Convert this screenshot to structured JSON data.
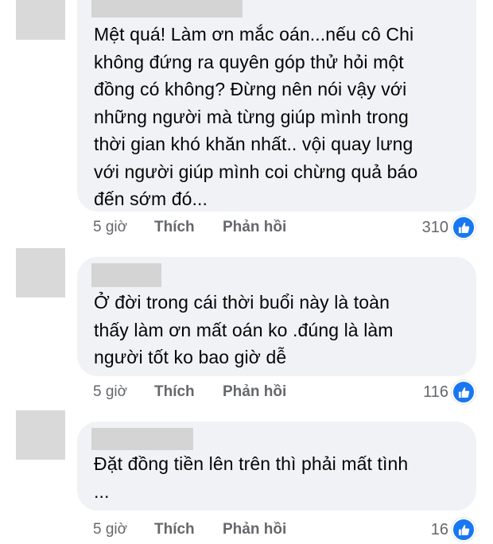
{
  "comments": [
    {
      "text": "Mệt quá! Làm ơn mắc oán...nếu cô Chi\nkhông đứng ra quyên góp thử hỏi một\nđồng có không? Đừng nên nói vậy với\nnhững người mà từng giúp mình trong\nthời gian khó khăn nhất.. vội quay lưng\nvới người giúp mình coi chừng quả báo\nđến sớm đó...",
      "time": "5 giờ",
      "like_label": "Thích",
      "reply_label": "Phản hồi",
      "reaction_count": "310"
    },
    {
      "text": "Ở đời trong cái thời buổi này là toàn\nthấy làm ơn mất oán ko .đúng là làm\nngười tốt ko bao giờ dễ",
      "time": "5 giờ",
      "like_label": "Thích",
      "reply_label": "Phản hồi",
      "reaction_count": "116"
    },
    {
      "text": "Đặt đồng tiền lên trên thì phải mất tình\n...",
      "time": "5 giờ",
      "like_label": "Thích",
      "reply_label": "Phản hồi",
      "reaction_count": "16"
    }
  ],
  "icons": {
    "reaction": "thumbs-up-icon"
  },
  "colors": {
    "bubble": "#f0f2f5",
    "like_blue": "#1877f2",
    "meta_gray": "#65676b"
  }
}
